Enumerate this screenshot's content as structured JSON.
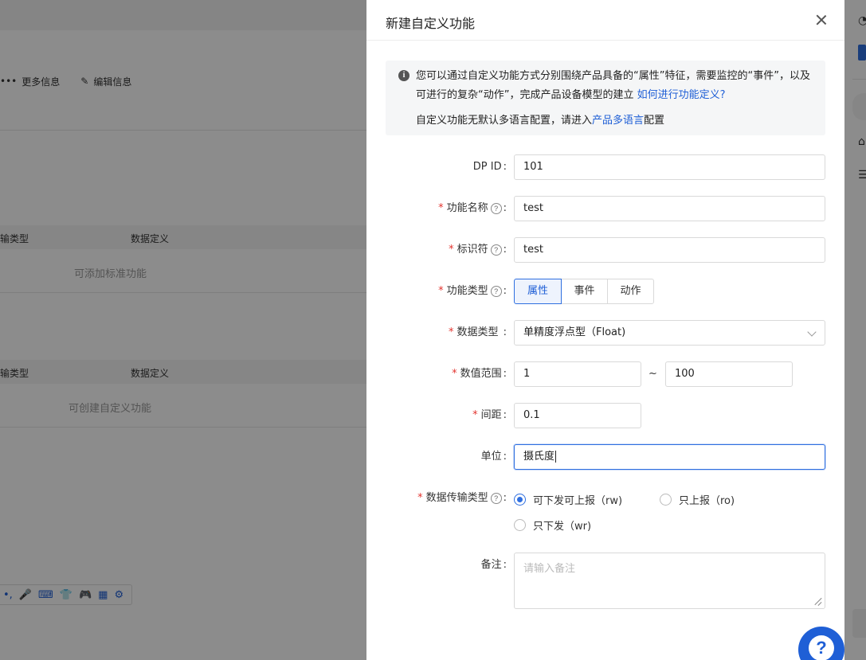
{
  "background": {
    "actions": [
      {
        "icon": "more-dots-icon",
        "label": "更多信息"
      },
      {
        "icon": "edit-icon",
        "label": "编辑信息"
      }
    ],
    "standard_table": {
      "col1": "输类型",
      "col2": "数据定义",
      "empty": "可添加标准功能"
    },
    "custom_table": {
      "col1": "输类型",
      "col2": "数据定义",
      "empty": "可创建自定义功能"
    }
  },
  "drawer": {
    "title": "新建自定义功能",
    "info": {
      "line1": "您可以通过自定义功能方式分别围绕产品具备的“属性”特征，需要监控的“事件”，以及可进行的复杂“动作”，完成产品设备模型的建立 ",
      "link1": "如何进行功能定义?",
      "line2_prefix": "自定义功能无默认多语言配置，请进入",
      "link2": "产品多语言",
      "line2_suffix": "配置"
    },
    "fields": {
      "dp_id": {
        "label": "DP ID",
        "value": "101"
      },
      "name": {
        "label": "功能名称",
        "value": "test"
      },
      "identifier": {
        "label": "标识符",
        "value": "test"
      },
      "func_type": {
        "label": "功能类型",
        "options": [
          "属性",
          "事件",
          "动作"
        ],
        "selected": "属性"
      },
      "data_type": {
        "label": "数据类型",
        "value": "单精度浮点型（Float)"
      },
      "range": {
        "label": "数值范围",
        "min": "1",
        "separator": "~",
        "max": "100"
      },
      "step": {
        "label": "间距",
        "value": "0.1"
      },
      "unit": {
        "label": "单位",
        "value": "摄氏度"
      },
      "transfer": {
        "label": "数据传输类型",
        "options": [
          "可下发可上报（rw)",
          "只上报（ro)",
          "只下发（wr)"
        ],
        "selected": "可下发可上报（rw)"
      },
      "remark": {
        "label": "备注",
        "placeholder": "请输入备注"
      }
    }
  },
  "help_button": {
    "label": "?"
  },
  "colors": {
    "accent": "#1f5fd6",
    "required": "#e3342f",
    "overlay": "rgba(0,0,0,0.45)"
  }
}
